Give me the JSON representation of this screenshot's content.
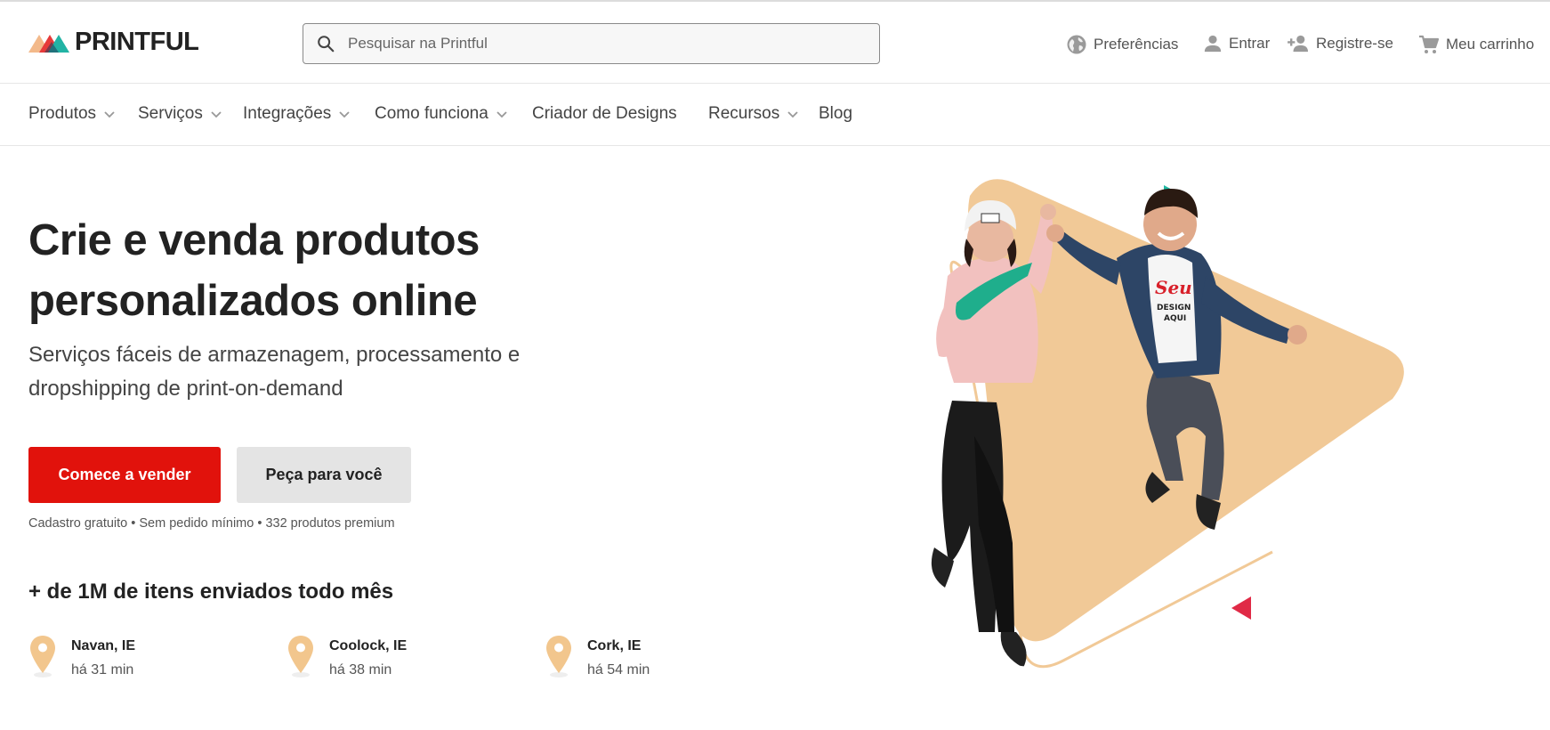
{
  "brand": {
    "name": "PRINTFUL"
  },
  "search": {
    "placeholder": "Pesquisar na Printful"
  },
  "header_links": [
    {
      "label": "Preferências",
      "icon": "globe-icon"
    },
    {
      "label": "Entrar",
      "icon": "user-icon"
    },
    {
      "label": "Registre-se",
      "icon": "add-user-icon"
    },
    {
      "label": "Meu carrinho",
      "icon": "cart-icon"
    }
  ],
  "nav": [
    {
      "label": "Produtos",
      "has_dropdown": true
    },
    {
      "label": "Serviços",
      "has_dropdown": true
    },
    {
      "label": "Integrações",
      "has_dropdown": true
    },
    {
      "label": "Como funciona",
      "has_dropdown": true
    },
    {
      "label": "Criador de Designs",
      "has_dropdown": false
    },
    {
      "label": "Recursos",
      "has_dropdown": true
    },
    {
      "label": "Blog",
      "has_dropdown": false
    }
  ],
  "hero": {
    "title_line1": "Crie e venda produtos",
    "title_line2": "personalizados online",
    "subtitle_line1": "Serviços fáceis de armazenagem, processamento e",
    "subtitle_line2": "dropshipping de print-on-demand",
    "primary_button": "Comece a vender",
    "secondary_button": "Peça para você",
    "fineprint": "Cadastro gratuito • Sem pedido mínimo • 332 produtos premium"
  },
  "stats": {
    "title": "+ de 1M de itens enviados todo mês",
    "locations": [
      {
        "city": "Navan, IE",
        "time": "há 31 min"
      },
      {
        "city": "Coolock, IE",
        "time": "há 38 min"
      },
      {
        "city": "Cork, IE",
        "time": "há 54 min"
      }
    ]
  },
  "hero_art": {
    "shirt_text_line1": "Seu",
    "shirt_text_line2": "DESIGN",
    "shirt_text_line3": "AQUI"
  },
  "colors": {
    "primary_red": "#e1120c",
    "secondary_gray": "#e4e4e4",
    "pin_color": "#f2c68d",
    "triangle_peach": "#f1c997",
    "accent_teal": "#20b9a3",
    "accent_red": "#e02a46"
  }
}
